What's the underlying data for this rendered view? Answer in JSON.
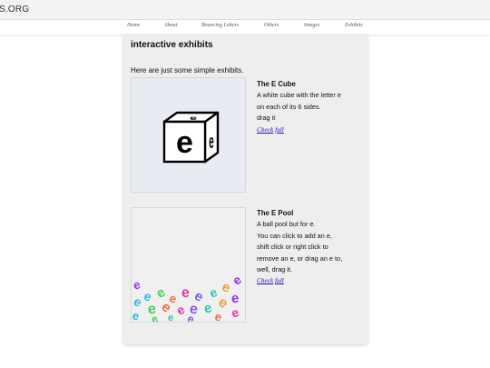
{
  "site": {
    "title": "S.ORG"
  },
  "nav": {
    "items": [
      {
        "label": "Home"
      },
      {
        "label": "About"
      },
      {
        "label": "Bouncing Letters"
      },
      {
        "label": "Others"
      },
      {
        "label": "Images"
      },
      {
        "label": "Exhibits"
      }
    ]
  },
  "main": {
    "heading": "interactive exhibits",
    "intro": "Here are just some simple exhibits.",
    "exhibits": [
      {
        "title": "The E Cube",
        "lines": [
          "A white cube with the letter e",
          "on each of its 6 sides.",
          "drag it"
        ],
        "check_label": "Check",
        "full_label": "full",
        "cube_letter": "e"
      },
      {
        "title": "The E Pool",
        "lines": [
          "A ball pool but for e.",
          "You can click to add an e,",
          "shift click or right click to",
          "remove an e, or drag an e to,",
          "well, drag it."
        ],
        "check_label": "Check",
        "full_label": "full",
        "pool_letter": "e",
        "pool_colors": [
          "#9b2cf0",
          "#2fb8e8",
          "#46d05a",
          "#f26a3a",
          "#e83aa8",
          "#7a5cf0",
          "#32c8a8",
          "#f0a030"
        ]
      }
    ]
  }
}
